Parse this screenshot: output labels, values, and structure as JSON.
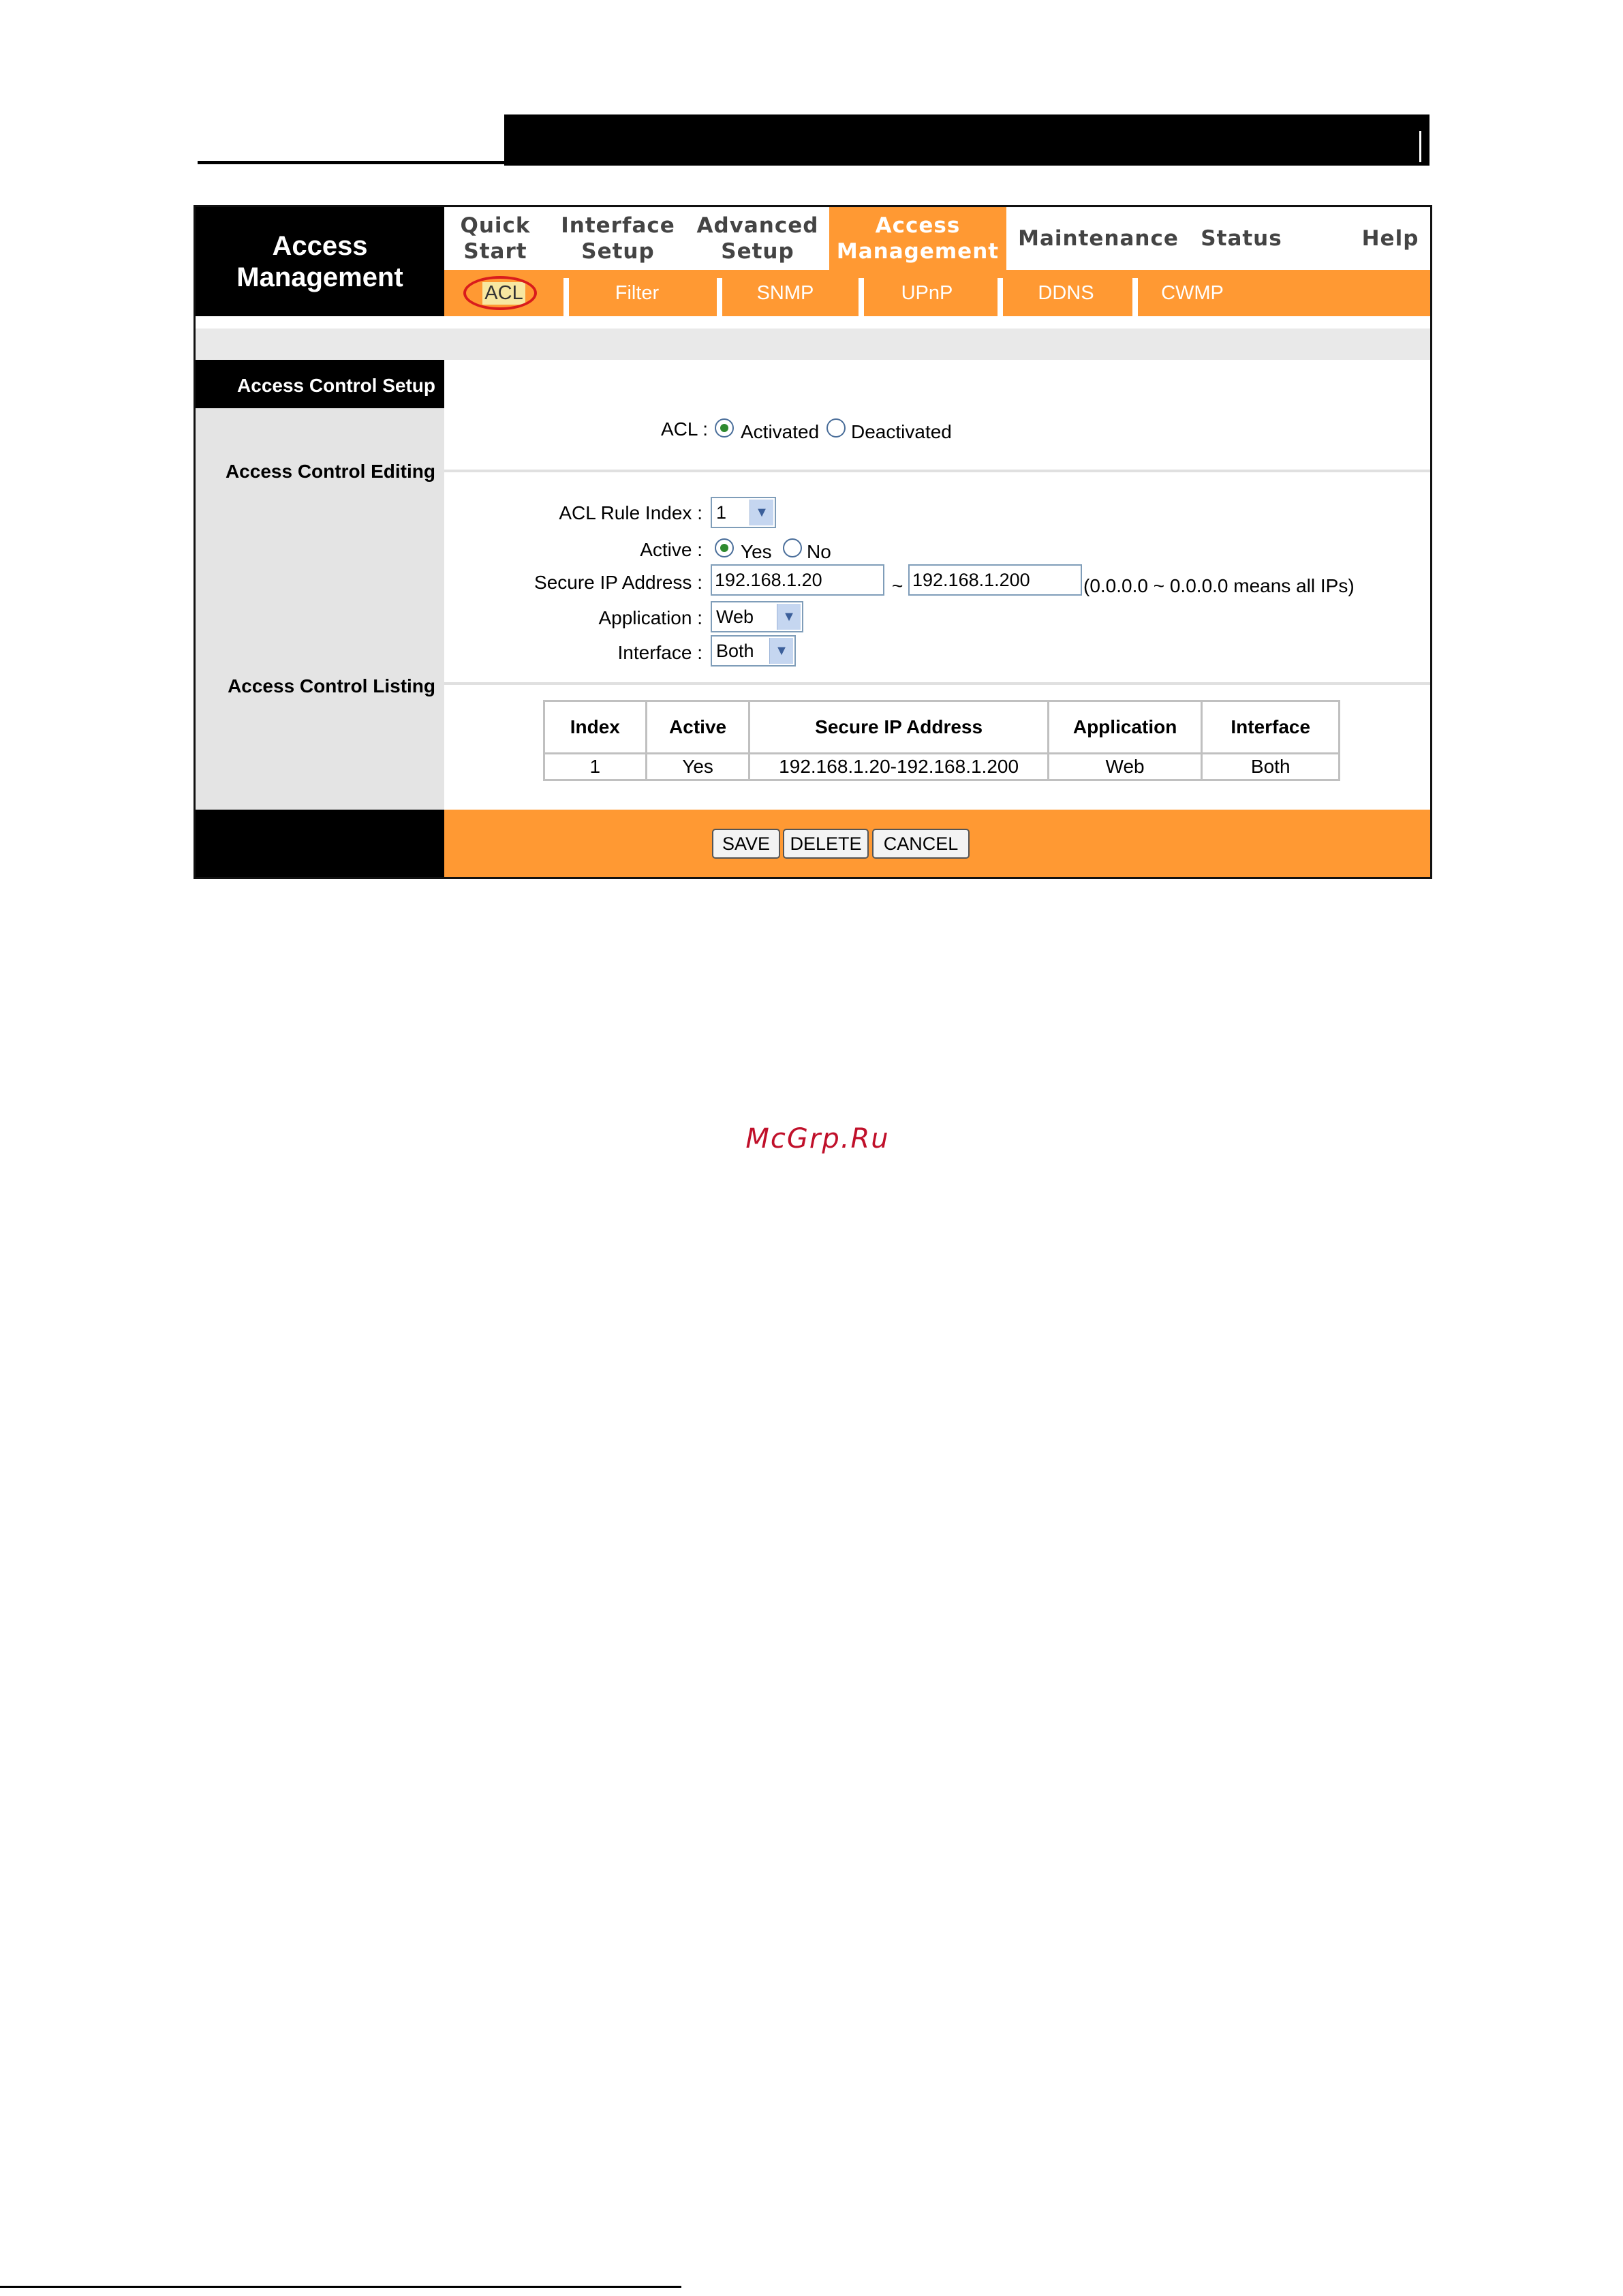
{
  "header": {
    "logo_line1": "Access",
    "logo_line2": "Management"
  },
  "tabs": [
    {
      "line1": "Quick",
      "line2": "Start"
    },
    {
      "line1": "Interface",
      "line2": "Setup"
    },
    {
      "line1": "Advanced",
      "line2": "Setup"
    },
    {
      "line1": "Access",
      "line2": "Management"
    },
    {
      "line1": "Maintenance",
      "line2": ""
    },
    {
      "line1": "Status",
      "line2": ""
    },
    {
      "line1": "Help",
      "line2": ""
    }
  ],
  "subtabs": [
    "ACL",
    "Filter",
    "SNMP",
    "UPnP",
    "DDNS",
    "CWMP"
  ],
  "sidebar": {
    "setup": "Access Control Setup",
    "editing": "Access Control Editing",
    "listing": "Access Control Listing"
  },
  "acl": {
    "label": "ACL :",
    "activated": "Activated",
    "deactivated": "Deactivated",
    "selected": "Activated"
  },
  "editing": {
    "rule_index_label": "ACL Rule Index :",
    "rule_index_value": "1",
    "active_label": "Active :",
    "active_yes": "Yes",
    "active_no": "No",
    "ip_label": "Secure IP Address :",
    "ip_start": "192.168.1.20",
    "ip_sep": "~",
    "ip_end": "192.168.1.200",
    "ip_hint": "(0.0.0.0 ~ 0.0.0.0 means all IPs)",
    "application_label": "Application :",
    "application_value": "Web",
    "interface_label": "Interface :",
    "interface_value": "Both"
  },
  "listing": {
    "columns": [
      "Index",
      "Active",
      "Secure IP Address",
      "Application",
      "Interface"
    ],
    "rows": [
      [
        "1",
        "Yes",
        "192.168.1.20-192.168.1.200",
        "Web",
        "Both"
      ]
    ]
  },
  "buttons": {
    "save": "SAVE",
    "delete": "DELETE",
    "cancel": "CANCEL"
  },
  "watermark": "McGrp.Ru",
  "colors": {
    "accent": "#ff9933",
    "header_bg": "#000000",
    "sidebar_bg": "#e4e4e4",
    "highlight_circle": "#d91c1c"
  }
}
